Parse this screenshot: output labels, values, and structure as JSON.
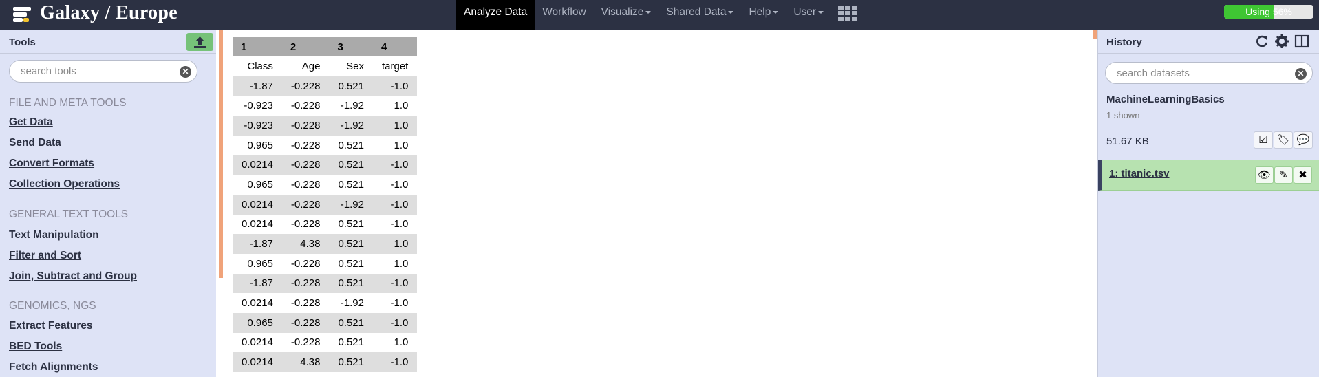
{
  "masthead": {
    "brand": "Galaxy / Europe",
    "nav": [
      {
        "label": "Analyze Data",
        "dropdown": false,
        "active": true
      },
      {
        "label": "Workflow",
        "dropdown": false,
        "active": false
      },
      {
        "label": "Visualize",
        "dropdown": true,
        "active": false
      },
      {
        "label": "Shared Data",
        "dropdown": true,
        "active": false
      },
      {
        "label": "Help",
        "dropdown": true,
        "active": false
      },
      {
        "label": "User",
        "dropdown": true,
        "active": false
      }
    ],
    "quota_text": "Using 56%",
    "quota_percent": 56
  },
  "tools": {
    "title": "Tools",
    "search_placeholder": "search tools",
    "sections": [
      {
        "title": "FILE AND META TOOLS",
        "items": [
          "Get Data",
          "Send Data",
          "Convert Formats",
          "Collection Operations"
        ]
      },
      {
        "title": "GENERAL TEXT TOOLS",
        "items": [
          "Text Manipulation",
          "Filter and Sort",
          "Join, Subtract and Group"
        ]
      },
      {
        "title": "GENOMICS, NGS",
        "items": [
          "Extract Features",
          "BED Tools",
          "Fetch Alignments"
        ]
      }
    ]
  },
  "table": {
    "header": [
      "1",
      "2",
      "3",
      "4"
    ],
    "column_names": [
      "Class",
      "Age",
      "Sex",
      "target"
    ],
    "rows": [
      [
        "-1.87",
        "-0.228",
        "0.521",
        "-1.0"
      ],
      [
        "-0.923",
        "-0.228",
        "-1.92",
        "1.0"
      ],
      [
        "-0.923",
        "-0.228",
        "-1.92",
        "1.0"
      ],
      [
        "0.965",
        "-0.228",
        "0.521",
        "1.0"
      ],
      [
        "0.0214",
        "-0.228",
        "0.521",
        "-1.0"
      ],
      [
        "0.965",
        "-0.228",
        "0.521",
        "-1.0"
      ],
      [
        "0.0214",
        "-0.228",
        "-1.92",
        "-1.0"
      ],
      [
        "0.0214",
        "-0.228",
        "0.521",
        "-1.0"
      ],
      [
        "-1.87",
        "4.38",
        "0.521",
        "1.0"
      ],
      [
        "0.965",
        "-0.228",
        "0.521",
        "1.0"
      ],
      [
        "-1.87",
        "-0.228",
        "0.521",
        "-1.0"
      ],
      [
        "0.0214",
        "-0.228",
        "-1.92",
        "-1.0"
      ],
      [
        "0.965",
        "-0.228",
        "0.521",
        "-1.0"
      ],
      [
        "0.0214",
        "-0.228",
        "0.521",
        "1.0"
      ],
      [
        "0.0214",
        "4.38",
        "0.521",
        "-1.0"
      ]
    ]
  },
  "history": {
    "title": "History",
    "search_placeholder": "search datasets",
    "name": "MachineLearningBasics",
    "shown": "1 shown",
    "size": "51.67 KB",
    "dataset_title": "1: titanic.tsv",
    "dataset_state_color": "#b7e2b0"
  }
}
